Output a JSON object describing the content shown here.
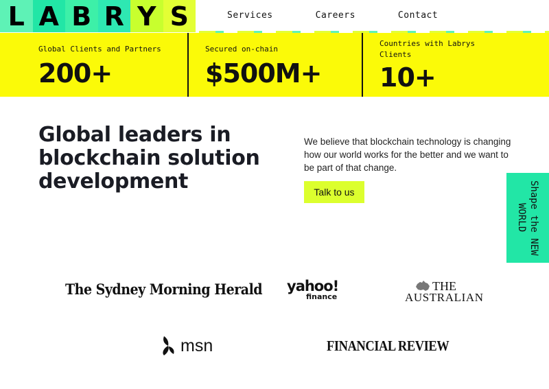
{
  "colors": {
    "stats_background": "#fbfa08",
    "accent_lime": "#dcff2e",
    "accent_green": "#22e6a6",
    "text_dark": "#1a1c24"
  },
  "logo": {
    "letters": [
      "L",
      "A",
      "B",
      "R",
      "Y",
      "S"
    ],
    "colors": [
      "#5ef2b6",
      "#22e6a6",
      "#3df0a8",
      "#2ee8b2",
      "#c8ff2e",
      "#e3ff35"
    ]
  },
  "nav": {
    "services": "Services",
    "careers": "Careers",
    "contact": "Contact"
  },
  "stats": [
    {
      "label": "Global Clients and Partners",
      "value": "200+"
    },
    {
      "label": "Secured on-chain",
      "value": "$500M+"
    },
    {
      "label": "Countries with Labrys Clients",
      "value": "10+"
    }
  ],
  "hero": {
    "title": "Global leaders in blockchain solution development",
    "description": "We believe that blockchain technology is changing how our world works for the better and we want to be part of that change.",
    "cta_label": "Talk to us"
  },
  "side_tab": {
    "label": "Shape the NEW WORLD"
  },
  "press": {
    "smh": "The Sydney Morning Herald",
    "yahoo_main": "yahoo!",
    "yahoo_sub": "finance",
    "australian_line1": "THE",
    "australian_line2": "AUSTRALIAN",
    "msn": "msn",
    "afr": "FINANCIAL REVIEW"
  }
}
